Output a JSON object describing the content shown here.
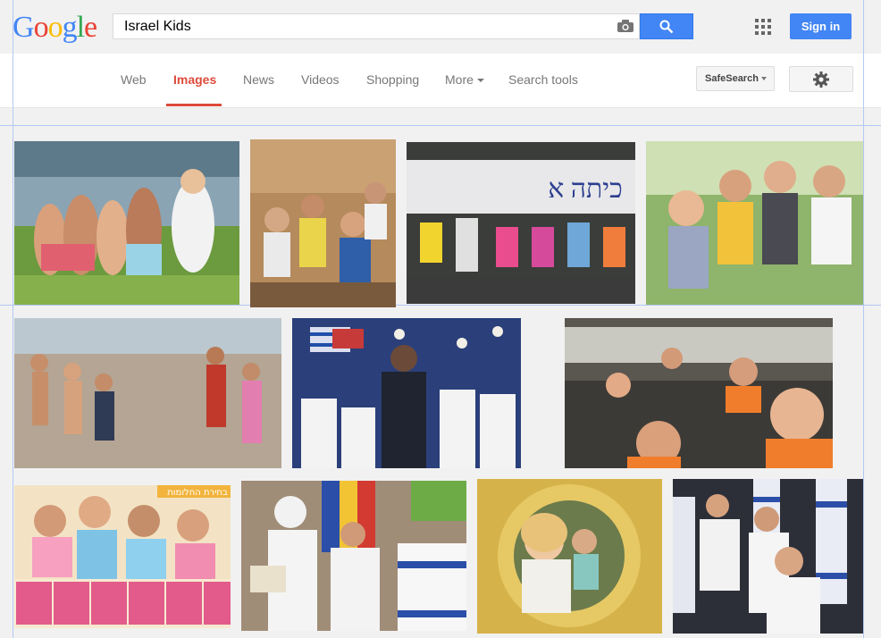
{
  "logo": {
    "letters": [
      "G",
      "o",
      "o",
      "g",
      "l",
      "e"
    ]
  },
  "search": {
    "query": "Israel Kids"
  },
  "header": {
    "sign_in_label": "Sign in"
  },
  "nav": {
    "tabs": [
      {
        "label": "Web"
      },
      {
        "label": "Images",
        "active": true
      },
      {
        "label": "News"
      },
      {
        "label": "Videos"
      },
      {
        "label": "Shopping"
      },
      {
        "label": "More"
      },
      {
        "label": "Search tools"
      }
    ],
    "safesearch_label": "SafeSearch"
  },
  "banner_text": "בחירת החלומות",
  "colors": {
    "accent_blue": "#4285f4",
    "active_red": "#dd4b39"
  },
  "icons": [
    "camera-icon",
    "search-icon",
    "apps-grid-icon",
    "gear-icon",
    "chevron-down-icon"
  ]
}
